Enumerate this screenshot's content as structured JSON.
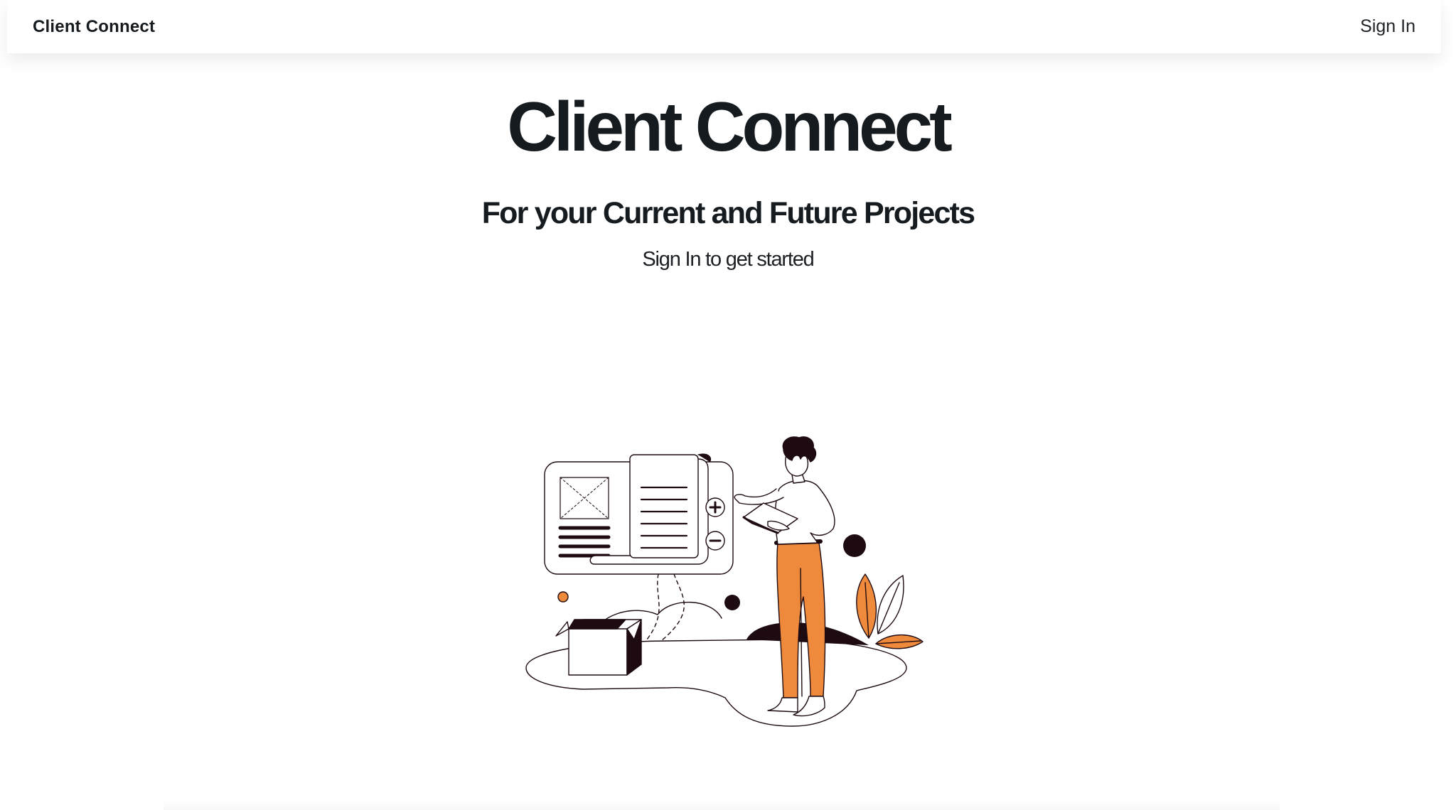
{
  "navbar": {
    "brand": "Client Connect",
    "signin_label": "Sign In"
  },
  "hero": {
    "title": "Client Connect",
    "subtitle": "For your Current and Future Projects",
    "tagline": "Sign In to get started"
  },
  "illustration": {
    "icon": "person-wireframe-illustration-icon",
    "accent_color": "#ef8a3c",
    "dark_color": "#1e0b12"
  }
}
